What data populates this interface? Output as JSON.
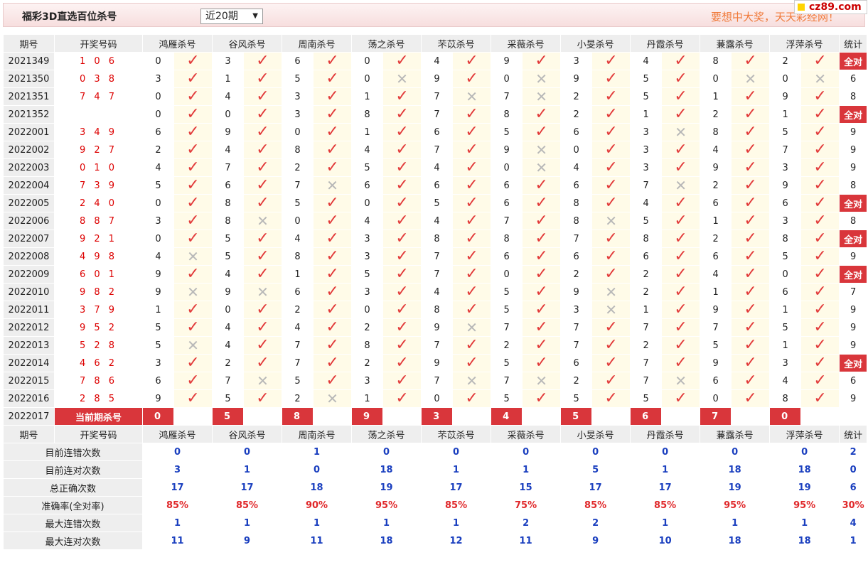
{
  "header": {
    "title": "福彩3D直选百位杀号",
    "range_select": "近20期",
    "slogan": "要想中大奖，天天彩经网！",
    "logo": "cz89.com"
  },
  "columns": {
    "period": "期号",
    "open_number": "开奖号码",
    "experts": [
      "鸿雁杀号",
      "谷风杀号",
      "周南杀号",
      "荡之杀号",
      "芣苡杀号",
      "采薇杀号",
      "小旻杀号",
      "丹霞杀号",
      "蒹露杀号",
      "浮萍杀号"
    ],
    "stat": "统计"
  },
  "rows": [
    {
      "period": "2021349",
      "open": "106",
      "kills": [
        0,
        3,
        6,
        0,
        4,
        9,
        3,
        4,
        8,
        2
      ],
      "hits": [
        1,
        1,
        1,
        1,
        1,
        1,
        1,
        1,
        1,
        1
      ],
      "stat": "全对"
    },
    {
      "period": "2021350",
      "open": "038",
      "kills": [
        3,
        1,
        5,
        0,
        9,
        0,
        9,
        5,
        0,
        0
      ],
      "hits": [
        1,
        1,
        1,
        0,
        1,
        0,
        1,
        1,
        0,
        0
      ],
      "stat": "6"
    },
    {
      "period": "2021351",
      "open": "747",
      "kills": [
        0,
        4,
        3,
        1,
        7,
        7,
        2,
        5,
        1,
        9
      ],
      "hits": [
        1,
        1,
        1,
        1,
        0,
        0,
        1,
        1,
        1,
        1
      ],
      "stat": "8"
    },
    {
      "period": "2021352",
      "open": "",
      "kills": [
        0,
        0,
        3,
        8,
        7,
        8,
        2,
        1,
        2,
        1
      ],
      "hits": [
        1,
        1,
        1,
        1,
        1,
        1,
        1,
        1,
        1,
        1
      ],
      "stat": "全对"
    },
    {
      "period": "2022001",
      "open": "349",
      "kills": [
        6,
        9,
        0,
        1,
        6,
        5,
        6,
        3,
        8,
        5
      ],
      "hits": [
        1,
        1,
        1,
        1,
        1,
        1,
        1,
        0,
        1,
        1
      ],
      "stat": "9"
    },
    {
      "period": "2022002",
      "open": "927",
      "kills": [
        2,
        4,
        8,
        4,
        7,
        9,
        0,
        3,
        4,
        7
      ],
      "hits": [
        1,
        1,
        1,
        1,
        1,
        0,
        1,
        1,
        1,
        1
      ],
      "stat": "9"
    },
    {
      "period": "2022003",
      "open": "010",
      "kills": [
        4,
        7,
        2,
        5,
        4,
        0,
        4,
        3,
        9,
        3
      ],
      "hits": [
        1,
        1,
        1,
        1,
        1,
        0,
        1,
        1,
        1,
        1
      ],
      "stat": "9"
    },
    {
      "period": "2022004",
      "open": "739",
      "kills": [
        5,
        6,
        7,
        6,
        6,
        6,
        6,
        7,
        2,
        9
      ],
      "hits": [
        1,
        1,
        0,
        1,
        1,
        1,
        1,
        0,
        1,
        1
      ],
      "stat": "8"
    },
    {
      "period": "2022005",
      "open": "240",
      "kills": [
        0,
        8,
        5,
        0,
        5,
        6,
        8,
        4,
        6,
        6
      ],
      "hits": [
        1,
        1,
        1,
        1,
        1,
        1,
        1,
        1,
        1,
        1
      ],
      "stat": "全对"
    },
    {
      "period": "2022006",
      "open": "887",
      "kills": [
        3,
        8,
        0,
        4,
        4,
        7,
        8,
        5,
        1,
        3
      ],
      "hits": [
        1,
        0,
        1,
        1,
        1,
        1,
        0,
        1,
        1,
        1
      ],
      "stat": "8"
    },
    {
      "period": "2022007",
      "open": "921",
      "kills": [
        0,
        5,
        4,
        3,
        8,
        8,
        7,
        8,
        2,
        8
      ],
      "hits": [
        1,
        1,
        1,
        1,
        1,
        1,
        1,
        1,
        1,
        1
      ],
      "stat": "全对"
    },
    {
      "period": "2022008",
      "open": "498",
      "kills": [
        4,
        5,
        8,
        3,
        7,
        6,
        6,
        6,
        6,
        5
      ],
      "hits": [
        0,
        1,
        1,
        1,
        1,
        1,
        1,
        1,
        1,
        1
      ],
      "stat": "9"
    },
    {
      "period": "2022009",
      "open": "601",
      "kills": [
        9,
        4,
        1,
        5,
        7,
        0,
        2,
        2,
        4,
        0
      ],
      "hits": [
        1,
        1,
        1,
        1,
        1,
        1,
        1,
        1,
        1,
        1
      ],
      "stat": "全对"
    },
    {
      "period": "2022010",
      "open": "982",
      "kills": [
        9,
        9,
        6,
        3,
        4,
        5,
        9,
        2,
        1,
        6
      ],
      "hits": [
        0,
        0,
        1,
        1,
        1,
        1,
        0,
        1,
        1,
        1
      ],
      "stat": "7"
    },
    {
      "period": "2022011",
      "open": "379",
      "kills": [
        1,
        0,
        2,
        0,
        8,
        5,
        3,
        1,
        9,
        1
      ],
      "hits": [
        1,
        1,
        1,
        1,
        1,
        1,
        0,
        1,
        1,
        1
      ],
      "stat": "9"
    },
    {
      "period": "2022012",
      "open": "952",
      "kills": [
        5,
        4,
        4,
        2,
        9,
        7,
        7,
        7,
        7,
        5
      ],
      "hits": [
        1,
        1,
        1,
        1,
        0,
        1,
        1,
        1,
        1,
        1
      ],
      "stat": "9"
    },
    {
      "period": "2022013",
      "open": "528",
      "kills": [
        5,
        4,
        7,
        8,
        7,
        2,
        7,
        2,
        5,
        1
      ],
      "hits": [
        0,
        1,
        1,
        1,
        1,
        1,
        1,
        1,
        1,
        1
      ],
      "stat": "9"
    },
    {
      "period": "2022014",
      "open": "462",
      "kills": [
        3,
        2,
        7,
        2,
        9,
        5,
        6,
        7,
        9,
        3
      ],
      "hits": [
        1,
        1,
        1,
        1,
        1,
        1,
        1,
        1,
        1,
        1
      ],
      "stat": "全对"
    },
    {
      "period": "2022015",
      "open": "786",
      "kills": [
        6,
        7,
        5,
        3,
        7,
        7,
        2,
        7,
        6,
        4
      ],
      "hits": [
        1,
        0,
        1,
        1,
        0,
        0,
        1,
        0,
        1,
        1
      ],
      "stat": "6"
    },
    {
      "period": "2022016",
      "open": "285",
      "kills": [
        9,
        5,
        2,
        1,
        0,
        5,
        5,
        5,
        0,
        8
      ],
      "hits": [
        1,
        1,
        0,
        1,
        1,
        1,
        1,
        1,
        1,
        1
      ],
      "stat": "9"
    }
  ],
  "current": {
    "period": "2022017",
    "label": "当前期杀号",
    "kills": [
      "0",
      "5",
      "8",
      "9",
      "3",
      "4",
      "5",
      "6",
      "7",
      "0"
    ]
  },
  "summary": [
    {
      "label": "目前连错次数",
      "values": [
        "0",
        "0",
        "1",
        "0",
        "0",
        "0",
        "0",
        "0",
        "0",
        "0"
      ],
      "stat": "2",
      "style": "blue"
    },
    {
      "label": "目前连对次数",
      "values": [
        "3",
        "1",
        "0",
        "18",
        "1",
        "1",
        "5",
        "1",
        "18",
        "18"
      ],
      "stat": "0",
      "style": "blue"
    },
    {
      "label": "总正确次数",
      "values": [
        "17",
        "17",
        "18",
        "19",
        "17",
        "15",
        "17",
        "17",
        "19",
        "19"
      ],
      "stat": "6",
      "style": "blue"
    },
    {
      "label": "准确率(全对率)",
      "values": [
        "85%",
        "85%",
        "90%",
        "95%",
        "85%",
        "75%",
        "85%",
        "85%",
        "95%",
        "95%"
      ],
      "stat": "30%",
      "style": "red"
    },
    {
      "label": "最大连错次数",
      "values": [
        "1",
        "1",
        "1",
        "1",
        "1",
        "2",
        "2",
        "1",
        "1",
        "1"
      ],
      "stat": "4",
      "style": "blue"
    },
    {
      "label": "最大连对次数",
      "values": [
        "11",
        "9",
        "11",
        "18",
        "12",
        "11",
        "9",
        "10",
        "18",
        "18"
      ],
      "stat": "1",
      "style": "blue"
    }
  ],
  "icons": {
    "hit": "check-icon",
    "miss": "cross-icon"
  }
}
